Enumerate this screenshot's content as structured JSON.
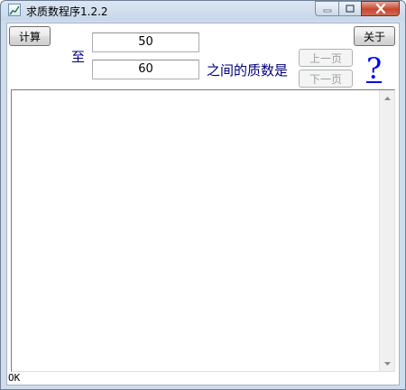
{
  "window": {
    "title": "求质数程序1.2.2"
  },
  "toolbar": {
    "compute_label": "计算",
    "about_label": "关于",
    "prev_page_label": "上一页",
    "next_page_label": "下一页",
    "help_symbol": "?"
  },
  "range": {
    "to_label": "至",
    "start_value": "50",
    "end_value": "60",
    "suffix_label": "之间的质数是"
  },
  "output": {
    "text": ""
  },
  "status": {
    "text": "OK"
  },
  "colors": {
    "label": "#00007a",
    "help": "#0000ff",
    "close": "#c8472f"
  }
}
